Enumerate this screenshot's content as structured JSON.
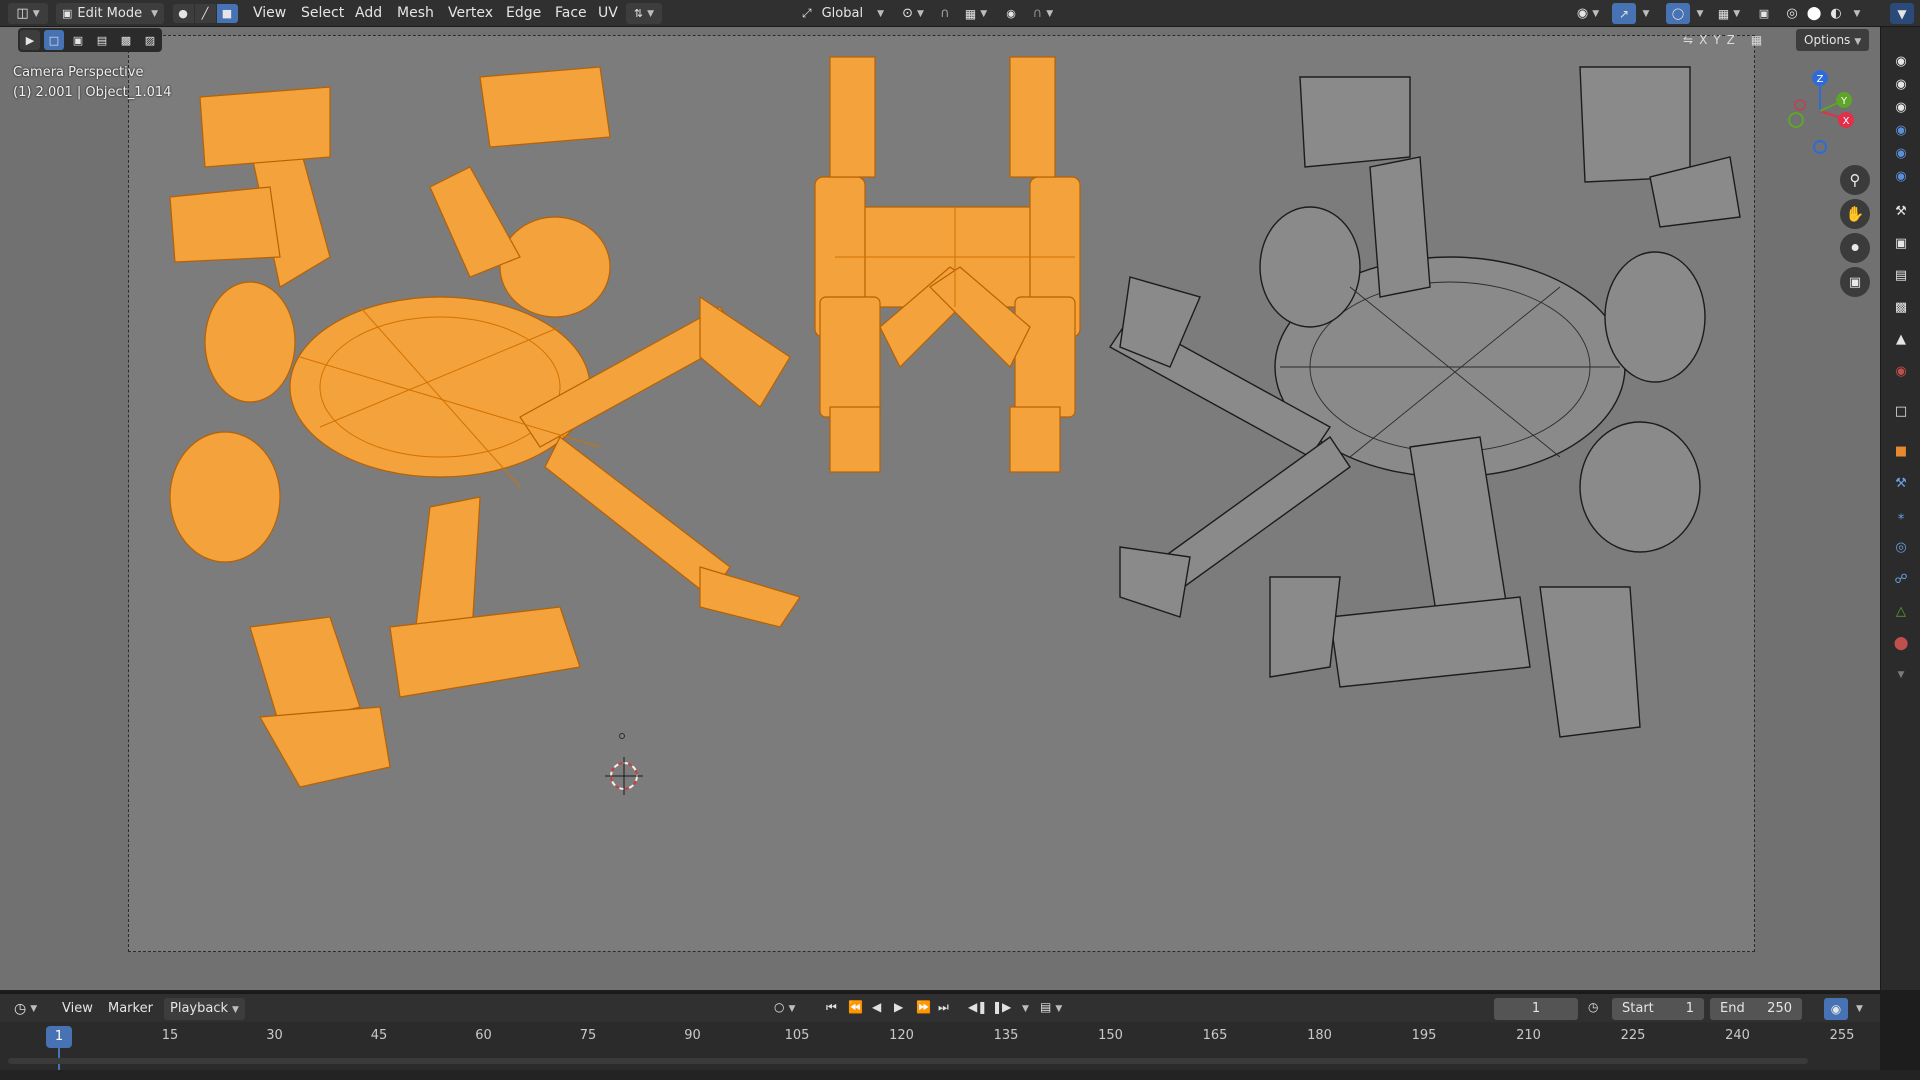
{
  "header": {
    "mode": "Edit Mode",
    "menus": [
      "View",
      "Select",
      "Add",
      "Mesh",
      "Vertex",
      "Edge",
      "Face",
      "UV"
    ],
    "transform_orientation": "Global"
  },
  "viewport": {
    "camera_label": "Camera Perspective",
    "object_label": "(1) 2.001 | Object_1.014",
    "axis_x": "X",
    "axis_y": "Y",
    "axis_z": "Z",
    "options_label": "Options"
  },
  "timeline": {
    "menus": [
      "View",
      "Marker",
      "Playback"
    ],
    "current_frame": "1",
    "start_label": "Start",
    "start_value": "1",
    "end_label": "End",
    "end_value": "250",
    "ticks": [
      "15",
      "30",
      "45",
      "60",
      "75",
      "90",
      "105",
      "120",
      "135",
      "150",
      "165",
      "180",
      "195",
      "210",
      "225",
      "240",
      "255"
    ],
    "playhead_frame": "1"
  },
  "colors": {
    "accent": "#4772b3",
    "selected_mesh": "#f3a23c",
    "unselected_mesh": "#2b2b2b"
  },
  "icons": {
    "editor_type": "3d-viewport-icon",
    "playback": [
      "jump-start-icon",
      "prev-keyframe-icon",
      "play-reverse-icon",
      "play-icon",
      "next-keyframe-icon",
      "jump-end-icon"
    ],
    "nav": [
      "zoom-icon",
      "pan-hand-icon",
      "camera-view-icon",
      "lock-icon"
    ]
  }
}
